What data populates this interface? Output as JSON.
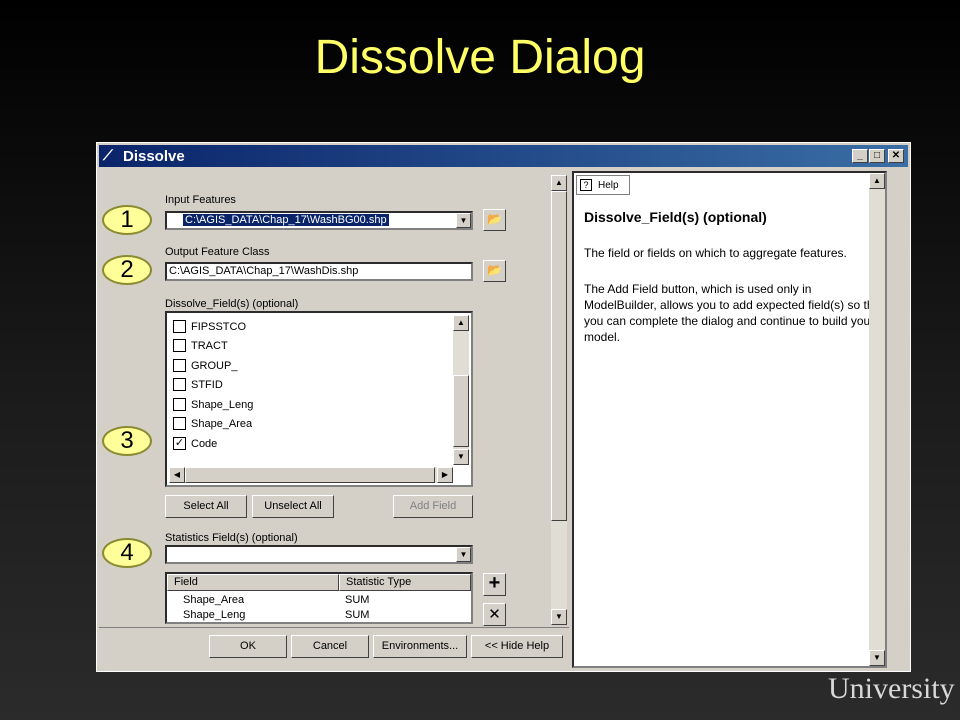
{
  "slide": {
    "title": "Dissolve Dialog",
    "logo_text": "University"
  },
  "window": {
    "title": "Dissolve",
    "min": "_",
    "max": "□",
    "close": "✕"
  },
  "form": {
    "input_label": "Input Features",
    "input_value": "C:\\AGIS_DATA\\Chap_17\\WashBG00.shp",
    "output_label": "Output Feature Class",
    "output_value": "C:\\AGIS_DATA\\Chap_17\\WashDis.shp",
    "dissolve_label": "Dissolve_Field(s) (optional)",
    "fields": [
      {
        "name": "FIPSSTCO",
        "checked": false
      },
      {
        "name": "TRACT",
        "checked": false
      },
      {
        "name": "GROUP_",
        "checked": false
      },
      {
        "name": "STFID",
        "checked": false
      },
      {
        "name": "Shape_Leng",
        "checked": false
      },
      {
        "name": "Shape_Area",
        "checked": false
      },
      {
        "name": "Code",
        "checked": true
      }
    ],
    "select_all": "Select All",
    "unselect_all": "Unselect All",
    "add_field": "Add Field",
    "stats_label": "Statistics Field(s) (optional)",
    "stats_value": "",
    "stats_columns": [
      "Field",
      "Statistic Type"
    ],
    "stats_rows": [
      {
        "field": "Shape_Area",
        "type": "SUM"
      },
      {
        "field": "Shape_Leng",
        "type": "SUM"
      }
    ],
    "add_icon": "+",
    "remove_icon": "✕"
  },
  "buttons": {
    "ok": "OK",
    "cancel": "Cancel",
    "environments": "Environments...",
    "hide_help": "<< Hide Help"
  },
  "help": {
    "tab": "Help",
    "title": "Dissolve_Field(s) (optional)",
    "p1": "The field or fields on which to aggregate features.",
    "p2": "The Add Field button, which is used only in ModelBuilder, allows you to add expected field(s) so that you can complete the dialog and continue to build your model."
  },
  "callouts": [
    "1",
    "2",
    "3",
    "4"
  ],
  "colors": {
    "title": "#ffff66",
    "titlebar": "#0a246a",
    "callout": "#ffff99"
  }
}
